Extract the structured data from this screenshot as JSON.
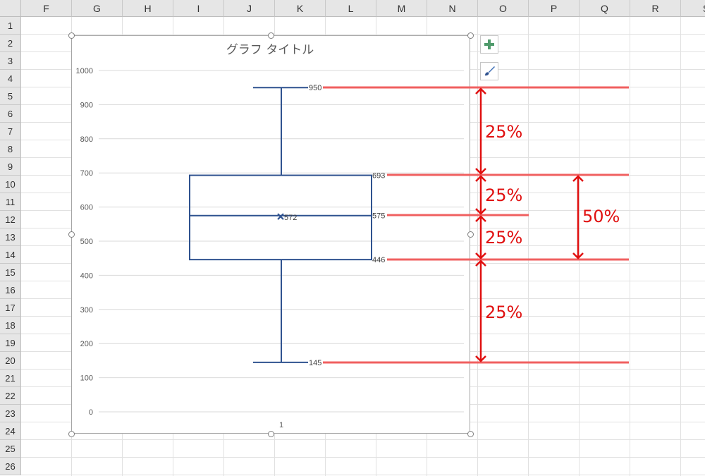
{
  "columns": [
    "F",
    "G",
    "H",
    "I",
    "J",
    "K",
    "L",
    "M",
    "N",
    "O",
    "P",
    "Q",
    "R",
    "S"
  ],
  "rows": [
    "1",
    "2",
    "3",
    "4",
    "5",
    "6",
    "7",
    "8",
    "9",
    "10",
    "11",
    "12",
    "13",
    "14",
    "15",
    "16",
    "17",
    "18",
    "19",
    "20",
    "21",
    "22",
    "23",
    "24",
    "25",
    "26"
  ],
  "chart_data": {
    "type": "box",
    "title": "グラフ タイトル",
    "categories": [
      "1"
    ],
    "ylim": [
      0,
      1000
    ],
    "yticks": [
      "0",
      "100",
      "200",
      "300",
      "400",
      "500",
      "600",
      "700",
      "800",
      "900",
      "1000"
    ],
    "box": {
      "min": 145,
      "q1": 446,
      "median": 575,
      "q3": 693,
      "max": 950,
      "mean": 572
    },
    "data_labels": [
      "950",
      "693",
      "575",
      "446",
      "145",
      "572"
    ],
    "box_color": "#2f528f",
    "gridlines": true
  },
  "annotations": {
    "line_color": "#f06060",
    "arrow_color": "#e01010",
    "labels": [
      "25%",
      "25%",
      "25%",
      "25%",
      "50%"
    ]
  },
  "buttons": {
    "add_element": "plus-icon",
    "chart_style": "brush-icon"
  }
}
